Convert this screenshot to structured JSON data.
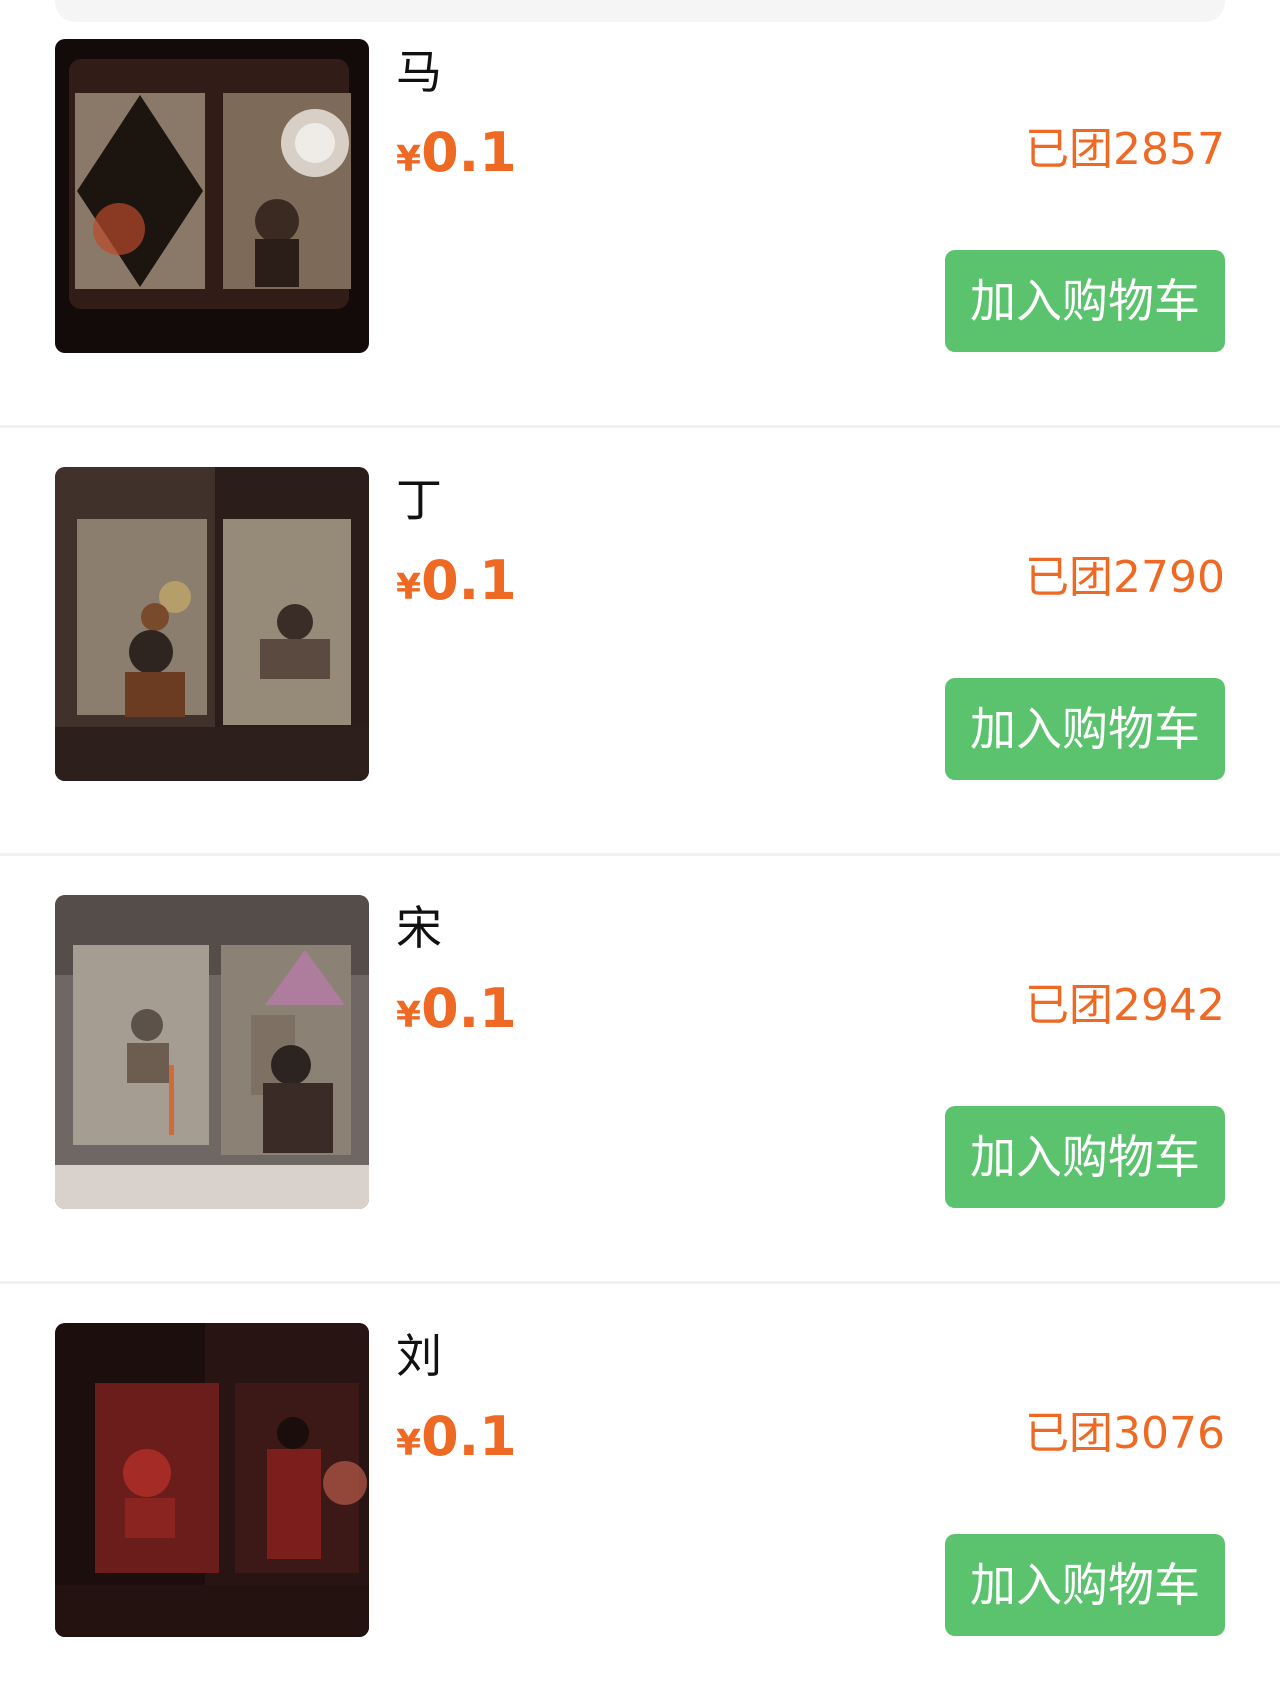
{
  "colors": {
    "accent_orange": "#ee6a24",
    "button_green": "#5bc36d",
    "divider": "#f1f1f1"
  },
  "items": [
    {
      "name": "马",
      "currency": "¥",
      "price": "0.1",
      "sold": "已团2857",
      "button_label": "加入购物车",
      "thumb_palette": [
        "#120b0a",
        "#3a201a",
        "#8a7868",
        "#b94a2b"
      ]
    },
    {
      "name": "丁",
      "currency": "¥",
      "price": "0.1",
      "sold": "已团2790",
      "button_label": "加入购物车",
      "thumb_palette": [
        "#2a1d1a",
        "#4c3a33",
        "#8b7e6e",
        "#c1a66a"
      ]
    },
    {
      "name": "宋",
      "currency": "¥",
      "price": "0.1",
      "sold": "已团2942",
      "button_label": "加入购物车",
      "thumb_palette": [
        "#6f6763",
        "#a59c92",
        "#8c8175",
        "#d06a3a"
      ]
    },
    {
      "name": "刘",
      "currency": "¥",
      "price": "0.1",
      "sold": "已团3076",
      "button_label": "加入购物车",
      "thumb_palette": [
        "#1b0e0d",
        "#3c1816",
        "#6b1d1c",
        "#a52b26"
      ]
    }
  ]
}
